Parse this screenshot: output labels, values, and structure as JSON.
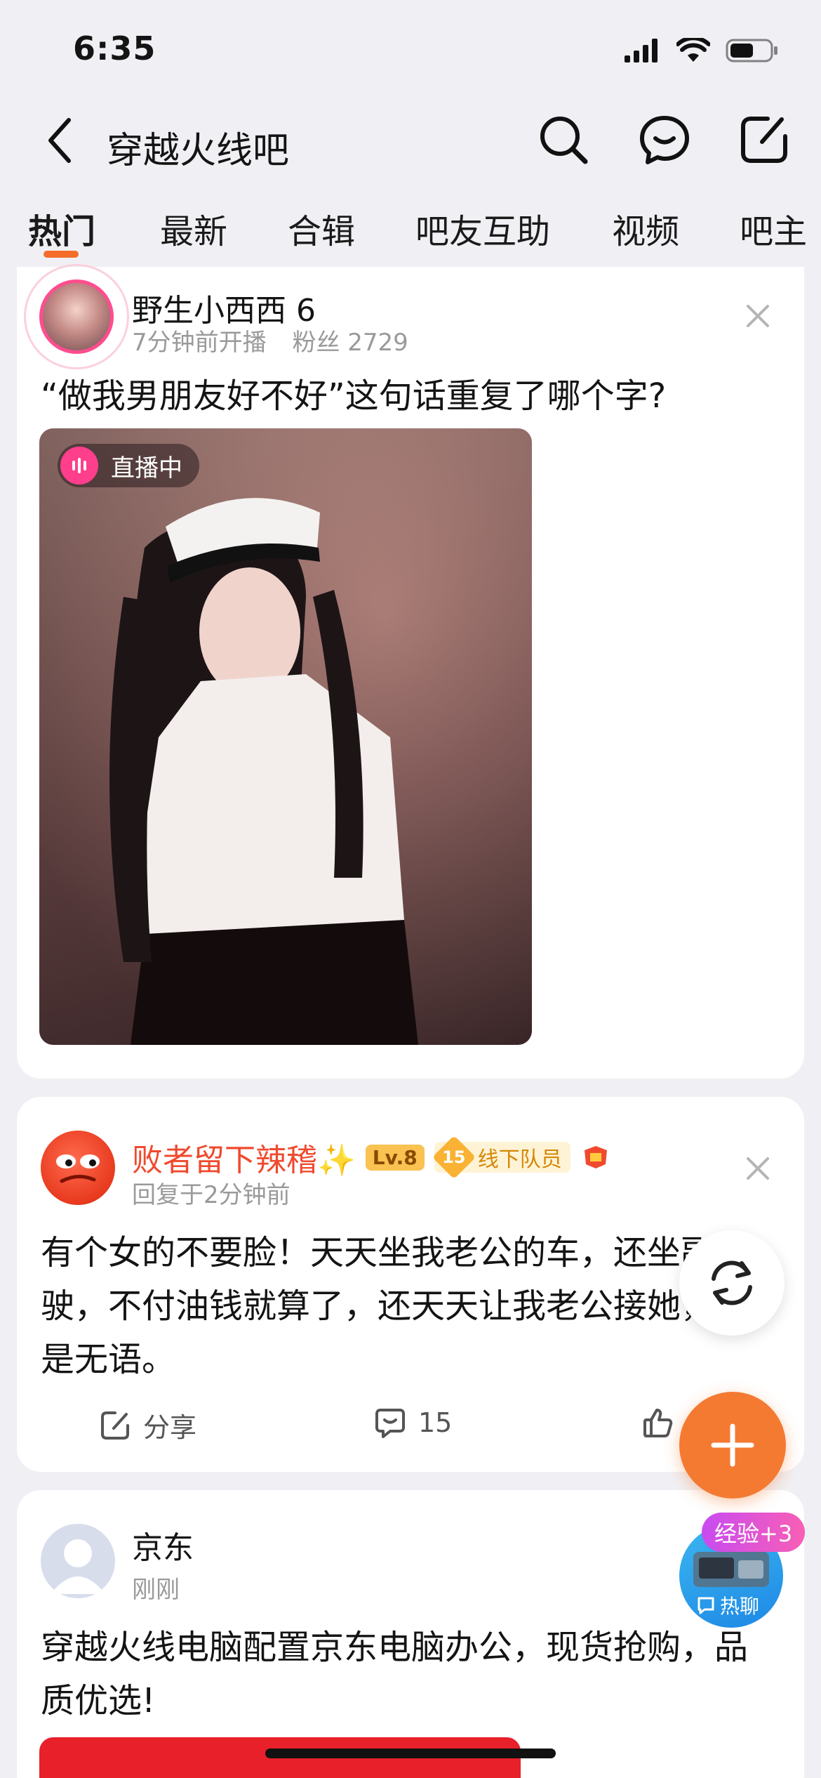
{
  "status_bar": {
    "time": "6:35"
  },
  "nav": {
    "title": "穿越火线吧"
  },
  "tabs": [
    {
      "label": "热门",
      "active": true
    },
    {
      "label": "最新"
    },
    {
      "label": "合辑"
    },
    {
      "label": "吧友互助"
    },
    {
      "label": "视频"
    },
    {
      "label": "吧主"
    }
  ],
  "posts": [
    {
      "author": "野生小西西 6",
      "meta_time": "7分钟前开播",
      "meta_fans": "粉丝 2729",
      "text": "“做我男朋友好不好”这句话重复了哪个字?",
      "badge": "直播中"
    },
    {
      "author": "败者留下辣稽✨",
      "level": "Lv.8",
      "role_num": "15",
      "role": "线下队员",
      "meta_time": "回复于2分钟前",
      "text": "有个女的不要脸！天天坐我老公的车，还坐副驾驶，不付油钱就算了，还天天让我老公接她，真是无语。",
      "share_label": "分享",
      "comment_count": "15"
    },
    {
      "author": "京东",
      "meta_time": "刚刚",
      "text": "穿越火线电脑配置京东电脑办公，现货抢购，品质优选!"
    }
  ],
  "floating": {
    "exp": "经验+3",
    "hot_chat": "热聊"
  },
  "colors": {
    "accent": "#F56D2B",
    "live": "#FF3E8C",
    "username_red": "#F04A2E"
  }
}
